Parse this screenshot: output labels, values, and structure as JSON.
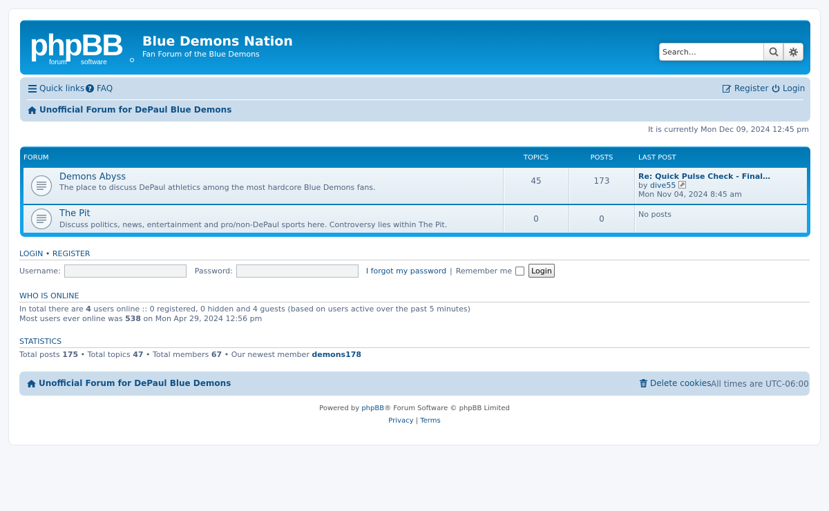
{
  "header": {
    "logo_text": "phpBB forum software",
    "site_title": "Blue Demons Nation",
    "site_description": "Fan Forum of the Blue Demons",
    "search_placeholder": "Search…",
    "search_icon": "magnifier-icon",
    "advanced_search_icon": "gear-icon"
  },
  "navbar": {
    "quick_links": "Quick links",
    "faq": "FAQ",
    "register": "Register",
    "login": "Login",
    "breadcrumb_home": "Unofficial Forum for DePaul Blue Demons"
  },
  "current_time": "It is currently Mon Dec 09, 2024 12:45 pm",
  "forum_table": {
    "headers": {
      "forum": "FORUM",
      "topics": "TOPICS",
      "posts": "POSTS",
      "last_post": "LAST POST"
    },
    "rows": [
      {
        "title": "Demons Abyss",
        "description": "The place to discuss DePaul athletics among the most hardcore Blue Demons fans.",
        "topics": "45",
        "posts": "173",
        "last_post_title": "Re: Quick Pulse Check - Final…",
        "last_post_by_prefix": "by",
        "last_post_author": "dive55",
        "last_post_date": "Mon Nov 04, 2024 8:45 am"
      },
      {
        "title": "The Pit",
        "description": "Discuss politics, news, entertainment and pro/non-DePaul sports here. Controversy lies within The Pit.",
        "topics": "0",
        "posts": "0",
        "last_post_text": "No posts"
      }
    ]
  },
  "login_section": {
    "login_link": "LOGIN",
    "separator": "•",
    "register_link": "REGISTER",
    "username_label": "Username:",
    "password_label": "Password:",
    "forgot_password": "I forgot my password",
    "divider": "|",
    "remember_me": "Remember me",
    "login_button": "Login"
  },
  "who_is_online": {
    "heading": "WHO IS ONLINE",
    "line1_pre": "In total there are",
    "line1_count": "4",
    "line1_post": "users online :: 0 registered, 0 hidden and 4 guests (based on users active over the past 5 minutes)",
    "line2_pre": "Most users ever online was",
    "line2_count": "538",
    "line2_post": "on Mon Apr 29, 2024 12:56 pm"
  },
  "statistics": {
    "heading": "STATISTICS",
    "total_posts_label": "Total posts",
    "total_posts": "175",
    "total_topics_label": "• Total topics",
    "total_topics": "47",
    "total_members_label": "• Total members",
    "total_members": "67",
    "newest_member_label": "• Our newest member",
    "newest_member": "demons178"
  },
  "footer": {
    "breadcrumb_home": "Unofficial Forum for DePaul Blue Demons",
    "delete_cookies": "Delete cookies",
    "timezone": "All times are UTC-06:00",
    "powered_by_pre": "Powered by",
    "powered_by_link": "phpBB",
    "powered_by_post": "® Forum Software © phpBB Limited",
    "privacy": "Privacy",
    "terms": "Terms",
    "sep": "|"
  },
  "colors": {
    "header_blue": "#12a3eb",
    "navbar_bg": "#cadceb",
    "link_blue": "#105289",
    "text_gray": "#536482"
  }
}
